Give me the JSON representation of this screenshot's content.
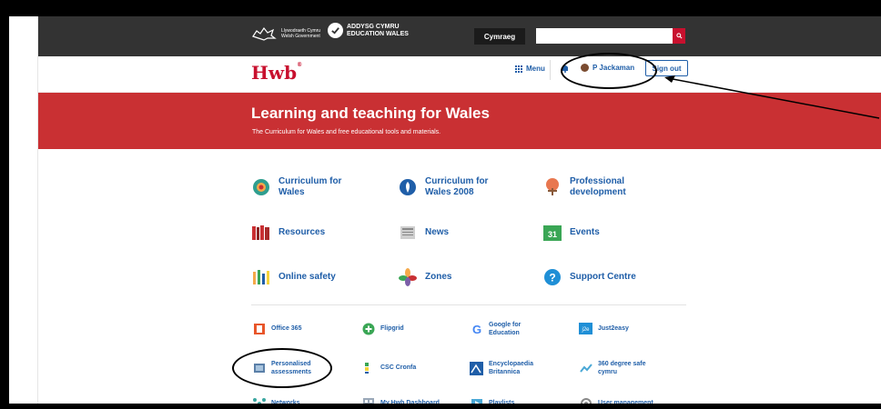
{
  "gov": {
    "welsh_gov_text": "Llywodraeth Cymru Welsh Government",
    "edu_title": "ADDYSG CYMRU EDUCATION WALES",
    "language_label": "Cymraeg",
    "search_placeholder": ""
  },
  "header": {
    "logo": "Hwb",
    "logo_mark": "®",
    "menu_label": "Menu",
    "user_name": "P Jackaman",
    "signout_label": "Sign out"
  },
  "banner": {
    "title": "Learning and teaching for Wales",
    "subtitle": "The Curriculum for Wales and free educational tools and materials."
  },
  "tiles": [
    {
      "label": "Curriculum for Wales",
      "icon": "curriculum-icon"
    },
    {
      "label": "Curriculum for Wales 2008",
      "icon": "curriculum-2008-icon"
    },
    {
      "label": "Professional development",
      "icon": "professional-development-icon"
    },
    {
      "label": "Resources",
      "icon": "books-icon"
    },
    {
      "label": "News",
      "icon": "newspaper-icon"
    },
    {
      "label": "Events",
      "icon": "calendar-icon"
    },
    {
      "label": "Online safety",
      "icon": "online-safety-icon"
    },
    {
      "label": "Zones",
      "icon": "zones-icon"
    },
    {
      "label": "Support Centre",
      "icon": "help-icon"
    }
  ],
  "calendar_day": "31",
  "services": [
    {
      "label": "Office 365",
      "icon": "office-365-icon"
    },
    {
      "label": "Flipgrid",
      "icon": "flipgrid-icon"
    },
    {
      "label": "Google for Education",
      "icon": "google-icon"
    },
    {
      "label": "Just2easy",
      "icon": "just2easy-icon"
    },
    {
      "label": "Personalised assessments",
      "icon": "assessment-icon"
    },
    {
      "label": "CSC Cronfa",
      "icon": "csc-cronfa-icon"
    },
    {
      "label": "Encyclopaedia Britannica",
      "icon": "britannica-icon"
    },
    {
      "label": "360 degree safe cymru",
      "icon": "360-safe-icon"
    },
    {
      "label": "Networks",
      "icon": "networks-icon"
    },
    {
      "label": "My Hwb Dashboard",
      "icon": "dashboard-icon"
    },
    {
      "label": "Playlists",
      "icon": "playlists-icon"
    },
    {
      "label": "User management",
      "icon": "user-management-icon"
    }
  ],
  "colors": {
    "brand_red": "#c93033",
    "link_blue": "#1f5ea8",
    "gov_bar": "#333333"
  }
}
